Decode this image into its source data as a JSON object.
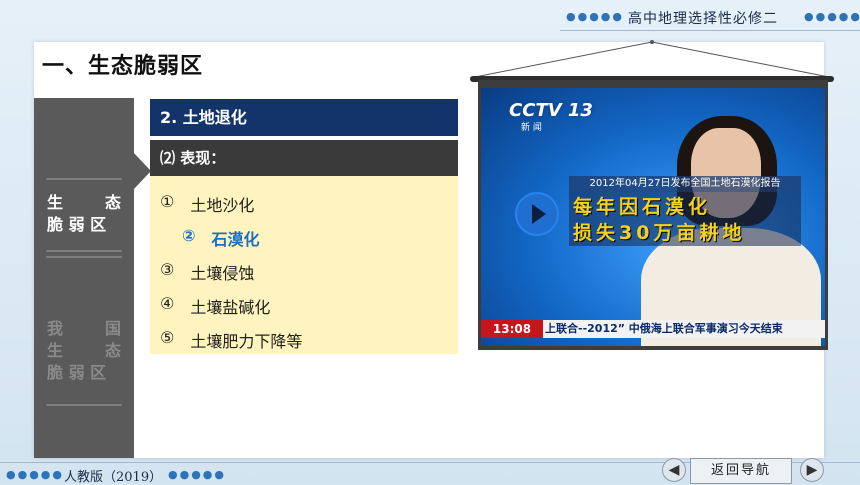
{
  "header": {
    "title": "高中地理选择性必修二",
    "dots": "●●●●●"
  },
  "section": {
    "title": "一、生态脆弱区"
  },
  "sidebar": {
    "items": [
      {
        "line1a": "生",
        "line1b": "态",
        "line2": "脆 弱 区"
      },
      {
        "line1a": "我",
        "line1b": "国",
        "line2a": "生",
        "line2b": "态",
        "line3": "脆 弱 区"
      }
    ]
  },
  "content": {
    "heading": "2.   土地退化",
    "subheading": "⑵  表现：",
    "items": [
      {
        "num": "①",
        "text": "土地沙化"
      },
      {
        "num": "②",
        "text": "石漠化"
      },
      {
        "num": "③",
        "text": "土壤侵蚀"
      },
      {
        "num": "④",
        "text": "土壤盐碱化"
      },
      {
        "num": "⑤",
        "text": "土壤肥力下降等"
      }
    ]
  },
  "video": {
    "logo": "CCTV 13",
    "logo_sub": "新 闻",
    "caption_top": "2012年04月27日发布全国土地石漠化报告",
    "caption_line1": "每年因石漠化",
    "caption_line2": "损失30万亩耕地",
    "ticker_time": "13:08",
    "ticker_text": "上联合--2012” 中俄海上联合军事演习今天结束"
  },
  "footer": {
    "publisher": "人教版（2019）",
    "home_label": "返回导航",
    "prev": "◀",
    "next": "▶"
  }
}
